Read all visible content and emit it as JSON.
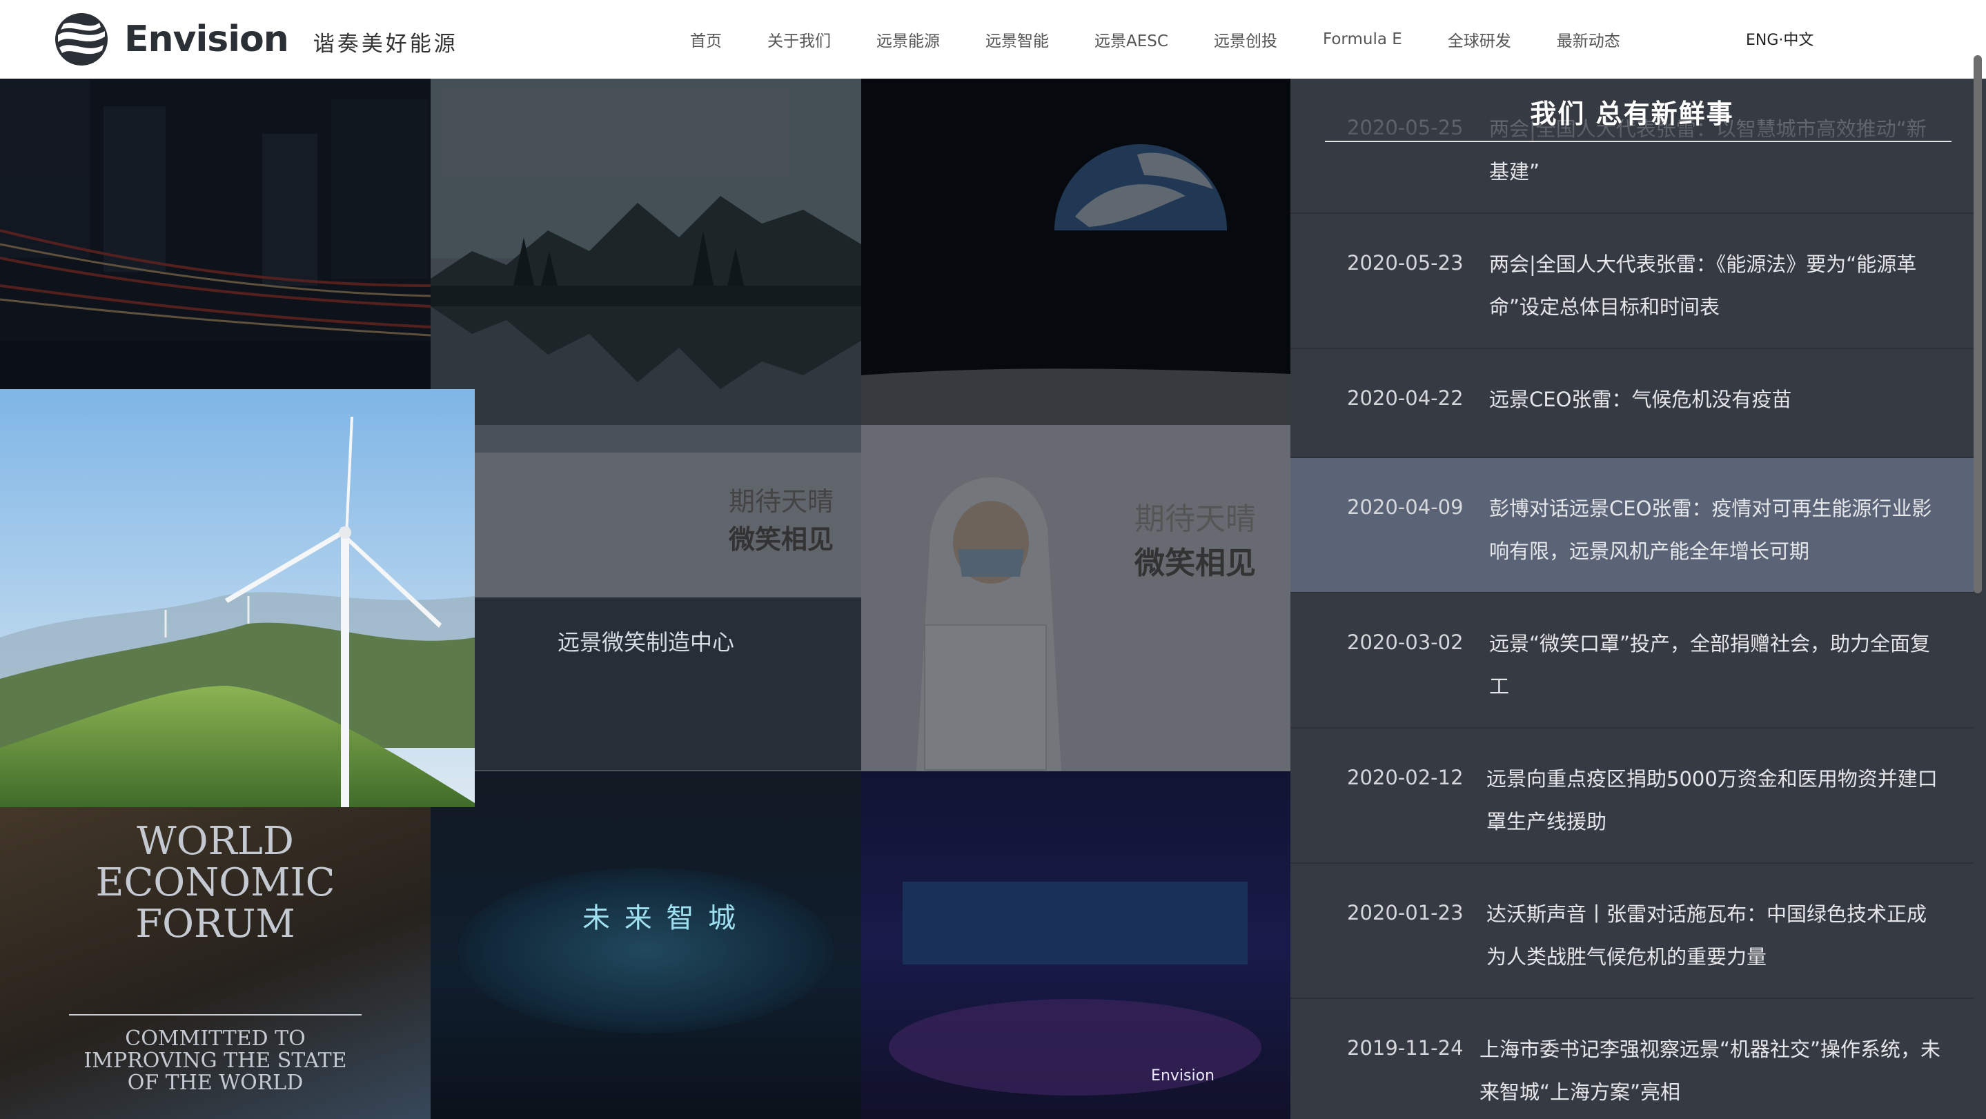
{
  "header": {
    "brand": "Envision",
    "tagline": "谐奏美好能源",
    "nav": [
      "首页",
      "关于我们",
      "远景能源",
      "远景智能",
      "远景AESC",
      "远景创投",
      "Formula E",
      "全球研发",
      "最新动态"
    ],
    "lang": "ENG·中文"
  },
  "mosaic": {
    "masks_caption_1": [
      "期待天晴",
      "微笑相见"
    ],
    "masks_caption_2": [
      "期待天晴",
      "微笑相见"
    ],
    "factory_sign": "远景微笑制造中心",
    "forum_name": [
      "WORLD",
      "ECONOMIC",
      "FORUM"
    ],
    "forum_motto": [
      "COMMITTED TO",
      "IMPROVING THE STATE",
      "OF THE WORLD"
    ],
    "smart_city_sign": "未 来 智 城",
    "event_logo": "Envision"
  },
  "panel": {
    "title": "我们 总有新鲜事",
    "news": [
      {
        "date": "2020-05-25",
        "title": "两会|全国人大代表张雷：以智慧城市高效推动“新基建”"
      },
      {
        "date": "2020-05-23",
        "title": "两会|全国人大代表张雷：《能源法》要为“能源革命”设定总体目标和时间表"
      },
      {
        "date": "2020-04-22",
        "title": "远景CEO张雷：气候危机没有疫苗"
      },
      {
        "date": "2020-04-09",
        "title": "彭博对话远景CEO张雷：疫情对可再生能源行业影响有限，远景风机产能全年增长可期"
      },
      {
        "date": "2020-03-02",
        "title": "远景“微笑口罩”投产，全部捐赠社会，助力全面复工"
      },
      {
        "date": "2020-02-12",
        "title": "远景向重点疫区捐助5000万资金和医用物资并建口罩生产线援助"
      },
      {
        "date": "2020-01-23",
        "title": "达沃斯声音丨张雷对话施瓦布：中国绿色技术正成为人类战胜气候危机的重要力量"
      },
      {
        "date": "2019-11-24",
        "title": "上海市委书记李强视察远景“机器社交”操作系统，未来智城“上海方案”亮相"
      }
    ],
    "active_index": 3
  },
  "colors": {
    "panel_bg": "#363a42",
    "active_row": "#5b6476",
    "header_bg": "#ffffff"
  }
}
